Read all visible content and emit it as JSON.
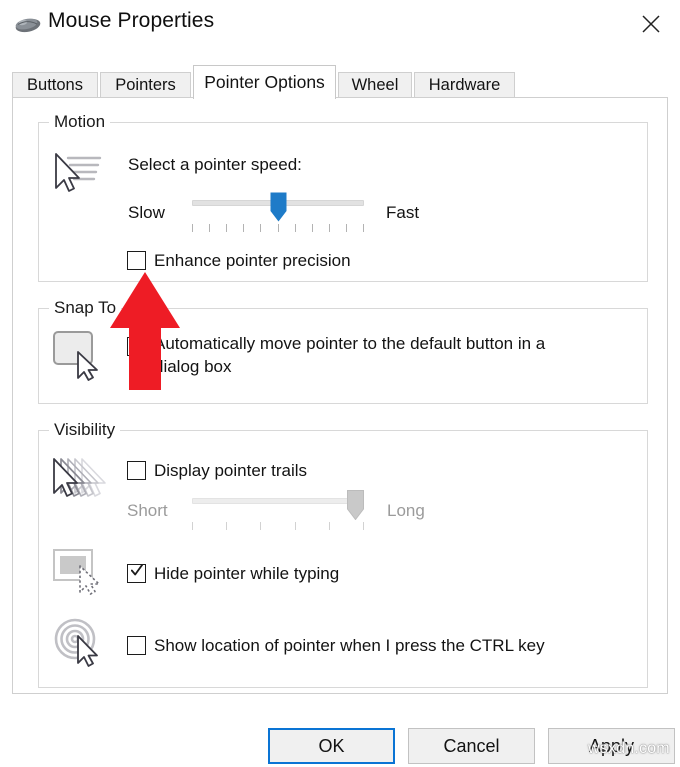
{
  "window": {
    "title": "Mouse Properties",
    "app_icon": "mouse-icon",
    "close_label": "✕"
  },
  "tabs": [
    {
      "label": "Buttons",
      "selected": false
    },
    {
      "label": "Pointers",
      "selected": false
    },
    {
      "label": "Pointer Options",
      "selected": true
    },
    {
      "label": "Wheel",
      "selected": false
    },
    {
      "label": "Hardware",
      "selected": false
    }
  ],
  "groups": {
    "motion": {
      "label": "Motion",
      "icon": "pointer-speed-icon",
      "speed_label": "Select a pointer speed:",
      "slider": {
        "min_label": "Slow",
        "max_label": "Fast",
        "value_percent": 50,
        "tick_count": 11,
        "enabled": true,
        "thumb_color": "#1E7BC8"
      },
      "checkbox": {
        "label": "Enhance pointer precision",
        "checked": false
      }
    },
    "snap_to": {
      "label": "Snap To",
      "icon": "default-button-pointer-icon",
      "checkbox": {
        "label": "Automatically move pointer to the default button in a dialog box",
        "checked": false
      }
    },
    "visibility": {
      "label": "Visibility",
      "trails": {
        "icon": "pointer-trails-icon",
        "checkbox": {
          "label": "Display pointer trails",
          "checked": false
        },
        "slider": {
          "min_label": "Short",
          "max_label": "Long",
          "value_percent": 100,
          "tick_count": 6,
          "enabled": false,
          "thumb_color": "#C9C9C9"
        }
      },
      "hide_typing": {
        "icon": "hide-pointer-typing-icon",
        "checkbox": {
          "label": "Hide pointer while typing",
          "checked": true
        }
      },
      "show_location": {
        "icon": "ctrl-locate-pointer-icon",
        "checkbox": {
          "label": "Show location of pointer when I press the CTRL key",
          "checked": false
        }
      }
    }
  },
  "buttons": {
    "ok": "OK",
    "cancel": "Cancel",
    "apply": "Apply",
    "focus_color": "#0A74D4"
  },
  "annotation": {
    "arrow": "red-up-arrow",
    "color": "#EE1C25",
    "points_at": "Enhance pointer precision"
  },
  "watermark": "wsxdn.com"
}
